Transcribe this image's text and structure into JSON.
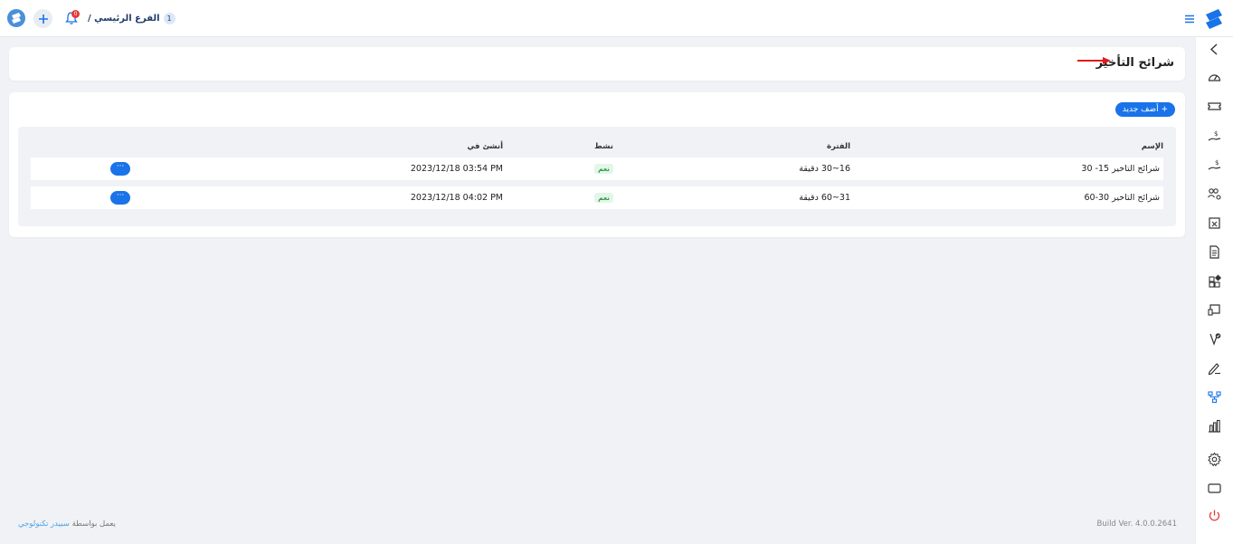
{
  "topbar": {
    "branch_number": "1",
    "branch_label": "الفرع الرئيسي /",
    "notification_count": "0"
  },
  "page": {
    "title": "شرائح التأخير",
    "add_button_label": "+ أضف جديد"
  },
  "table": {
    "headers": {
      "name": "الإسم",
      "period": "الفترة",
      "active": "نشط",
      "created_at": "أنشئ في"
    },
    "rows": [
      {
        "name": "شرائح التاخير 15- 30",
        "period": "16~30 دقيقة",
        "active": "نعم",
        "created_at": "2023/12/18 03:54 PM",
        "actions": "···"
      },
      {
        "name": "شرائح التاخير 30-60",
        "period": "31~60 دقيقة",
        "active": "نعم",
        "created_at": "2023/12/18 04:02 PM",
        "actions": "···"
      }
    ]
  },
  "footer": {
    "powered_by": "يعمل بواسطة",
    "company": "سبيدر تكنولوجي",
    "build": "Build Ver. 4.0.0.2641"
  },
  "icons": {
    "sidebar": [
      "chevron-left-icon",
      "dashboard-icon",
      "ticket-icon",
      "salary-icon",
      "payroll-icon",
      "users-settings-icon",
      "calendar-x-icon",
      "document-icon",
      "apps-add-icon",
      "device-icon",
      "approval-icon",
      "signature-icon",
      "hierarchy-icon",
      "bar-chart-icon",
      "gear-icon",
      "tablet-icon",
      "power-icon"
    ]
  },
  "colors": {
    "accent": "#1a73e8",
    "active_badge_bg": "#e3f6e8",
    "active_badge_text": "#2e9a48",
    "annotation_arrow": "#e0191b",
    "power": "#e53935"
  }
}
